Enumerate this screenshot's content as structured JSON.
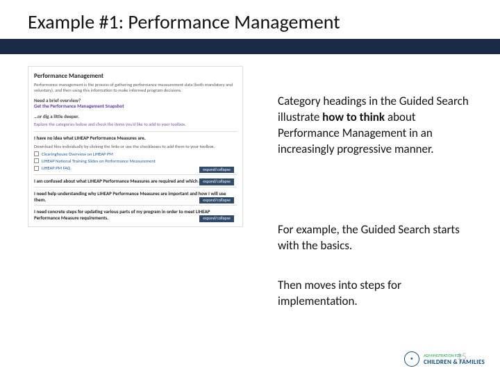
{
  "title": "Example #1:  Performance Management",
  "screenshot": {
    "sectionTitle": "Performance Management",
    "blurb": "Performance management is the process of gathering performance measurement data (both mandatory and voluntary), and then using this information to make informed program decisions.",
    "overviewQ": "Need a brief overview?",
    "snapshotLink": "Get the Performance Management Snapshot",
    "dig": "…or dig a little deeper.",
    "instruct": "Explore the categories below and check the items you’d like to add to your toolbox.",
    "cat1": {
      "heading": "I have no idea what LIHEAP Performance Measures are.",
      "dl": "Download files individually by clicking the links or use the checkboxes to add them to your toolbox.",
      "item1": "Clearinghouse Overview on LIHEAP PM",
      "item2": "LIHEAP National Training Slides on Performance Measurement",
      "item3": "LIHEAP PM FAQ",
      "ec": "expand/collapse"
    },
    "cat2": {
      "heading": "I am confused about what LIHEAP Performance Measures are required and which are voluntary.",
      "ec": "expand/collapse"
    },
    "cat3": {
      "heading": "I need help understanding why LIHEAP Performance Measures are important and how I will use them.",
      "ec": "expand/collapse"
    },
    "cat4": {
      "heading": "I need concrete steps for updating various parts of my program in order to meet LIHEAP Performance Measure requirements.",
      "ec": "expand/collapse"
    }
  },
  "ann1_a": "Category headings in the Guided Search illustrate ",
  "ann1_b": "how to think",
  "ann1_c": " about Performance Management in an increasingly progressive manner.",
  "ann2": "For example, the Guided Search starts with the basics.",
  "ann3": "Then moves into steps for implementation.",
  "footer": {
    "line1": "CHILDREN",
    "line2": "& FAMILIES",
    "small": "ADMINISTRATION FOR"
  },
  "pagenum": "15"
}
